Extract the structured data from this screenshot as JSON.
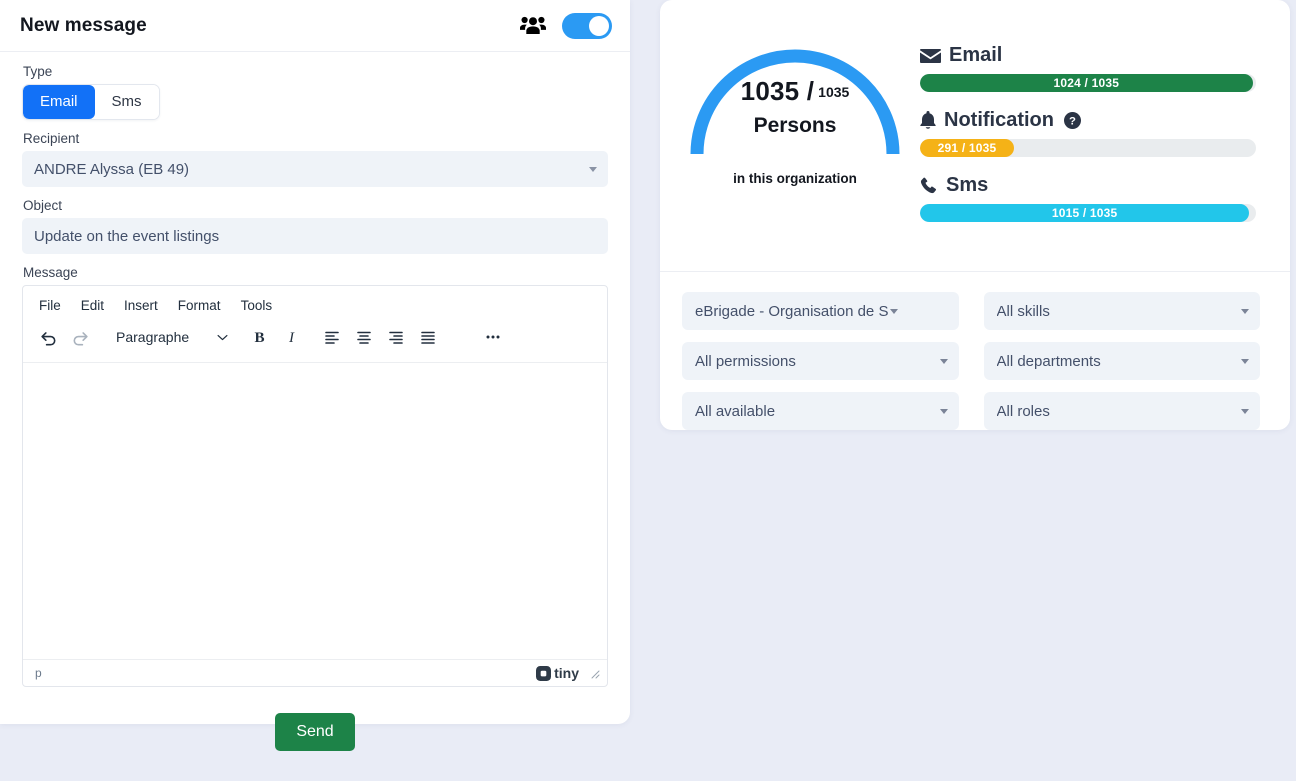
{
  "compose": {
    "title": "New message",
    "people_icon": "people-icon",
    "toggle_on": true,
    "type": {
      "label": "Type",
      "options": [
        "Email",
        "Sms"
      ],
      "selected": "Email"
    },
    "recipient": {
      "label": "Recipient",
      "value": "ANDRE Alyssa (EB 49)"
    },
    "object": {
      "label": "Object",
      "value": "Update on the event listings"
    },
    "message": {
      "label": "Message",
      "menus": [
        "File",
        "Edit",
        "Insert",
        "Format",
        "Tools"
      ],
      "format_block": "Paragraphe",
      "toolbar_icons": [
        "undo-icon",
        "redo-icon",
        "bold-icon",
        "italic-icon",
        "align-left-icon",
        "align-center-icon",
        "align-right-icon",
        "align-justify-icon",
        "more-options-icon"
      ],
      "body": "",
      "status_path": "p",
      "brand": "tiny"
    },
    "send_label": "Send"
  },
  "stats": {
    "gauge": {
      "value": "1035 /",
      "total": "1035",
      "unit": "Persons",
      "caption": "in this organization",
      "color": "#2b9af3",
      "percent": 100
    },
    "channels": [
      {
        "name": "Email",
        "icon": "envelope-icon",
        "text": "1024 / 1035",
        "value": 1024,
        "total": 1035,
        "percent": 99,
        "color": "#1d8348",
        "has_help": false
      },
      {
        "name": "Notification",
        "icon": "bell-icon",
        "text": "291 / 1035",
        "value": 291,
        "total": 1035,
        "percent": 28,
        "color": "#f5b217",
        "has_help": true,
        "help_icon": "help-icon"
      },
      {
        "name": "Sms",
        "icon": "phone-icon",
        "text": "1015 / 1035",
        "value": 1015,
        "total": 1035,
        "percent": 98,
        "color": "#22c6ea",
        "has_help": false
      }
    ]
  },
  "filters": [
    {
      "value": "eBrigade - Organisation de S",
      "name": "organisation"
    },
    {
      "value": "All skills",
      "name": "skills"
    },
    {
      "value": "All permissions",
      "name": "permissions"
    },
    {
      "value": "All departments",
      "name": "departments"
    },
    {
      "value": "All available",
      "name": "available"
    },
    {
      "value": "All roles",
      "name": "roles"
    }
  ]
}
